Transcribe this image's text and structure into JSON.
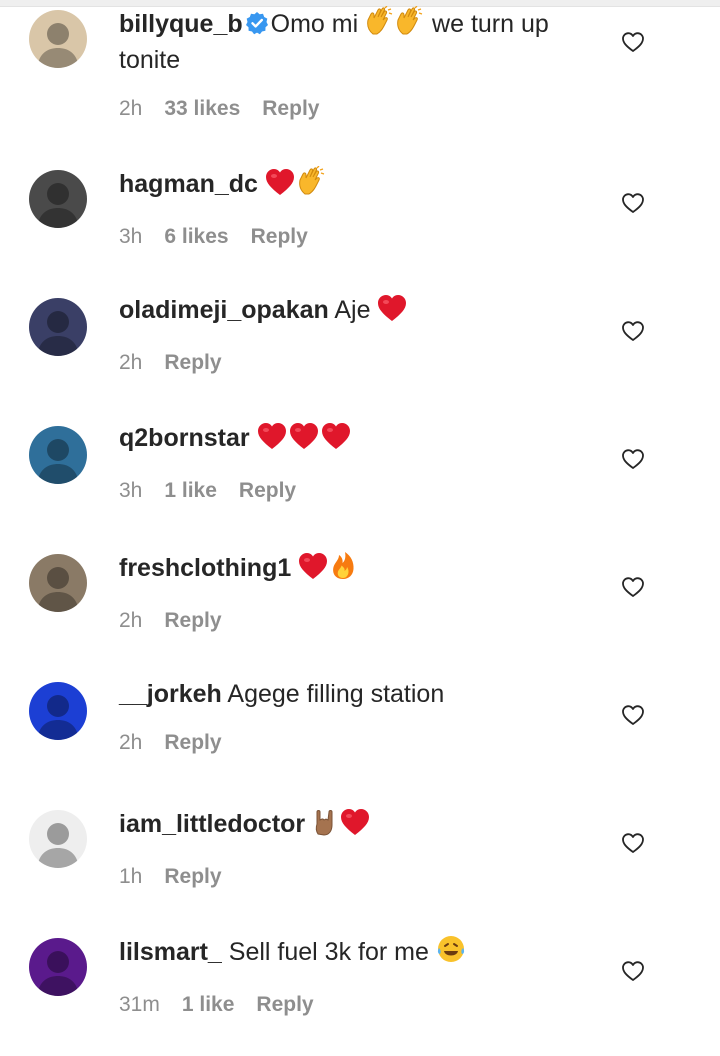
{
  "comments": [
    {
      "username": "billyque_b",
      "verified": true,
      "emojis_before": [
        "clap-icon",
        "clap-icon"
      ],
      "text": "Omo mi",
      "text_after": "we turn up tonite",
      "time": "2h",
      "likes": "33 likes",
      "reply": "Reply",
      "avatar_color": "#d9c6a8"
    },
    {
      "username": "hagman_dc",
      "verified": false,
      "text": "",
      "emojis": [
        "heart-red-icon",
        "clap-icon"
      ],
      "time": "3h",
      "likes": "6 likes",
      "reply": "Reply",
      "avatar_color": "#4a4a4a"
    },
    {
      "username": "oladimeji_opakan",
      "verified": false,
      "text": "Aje",
      "emojis": [
        "heart-red-icon"
      ],
      "time": "2h",
      "likes": "",
      "reply": "Reply",
      "avatar_color": "#3a3f66"
    },
    {
      "username": "q2bornstar",
      "verified": false,
      "text": "",
      "emojis": [
        "heart-red-icon",
        "heart-red-icon",
        "heart-red-icon"
      ],
      "time": "3h",
      "likes": "1 like",
      "reply": "Reply",
      "avatar_color": "#2f6f9a"
    },
    {
      "username": "freshclothing1",
      "verified": false,
      "text": "",
      "emojis": [
        "heart-red-icon",
        "fire-icon"
      ],
      "time": "2h",
      "likes": "",
      "reply": "Reply",
      "avatar_color": "#8a7a66"
    },
    {
      "username": "__jorkeh",
      "verified": false,
      "text": "Agege filling station",
      "emojis": [],
      "time": "2h",
      "likes": "",
      "reply": "Reply",
      "avatar_color": "#1c3fd4"
    },
    {
      "username": "iam_littledoctor",
      "verified": false,
      "text": "",
      "emojis": [
        "rock-hand-icon",
        "heart-red-icon"
      ],
      "time": "1h",
      "likes": "",
      "reply": "Reply",
      "avatar_color": "#eeeeee"
    },
    {
      "username": "lilsmart_",
      "verified": false,
      "text": "Sell fuel 3k for me",
      "emojis": [
        "laughing-tears-icon"
      ],
      "time": "31m",
      "likes": "1 like",
      "reply": "Reply",
      "avatar_color": "#5a1a8c"
    }
  ],
  "colors": {
    "heart": "#e0172b",
    "meta": "#8e8e8e",
    "verified": "#3897f0"
  }
}
